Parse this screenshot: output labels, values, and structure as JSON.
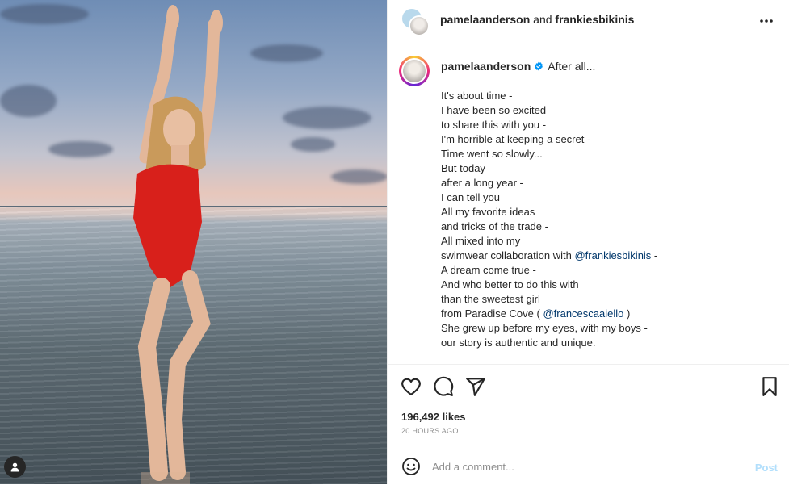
{
  "post": {
    "authors": "pamelaanderson",
    "authors_joiner": "and",
    "collaborator": "frankiesbikinis",
    "colors": {
      "accent": "#0095f6",
      "post_disabled": "#b2dffc",
      "mention": "#00376b",
      "swimsuit": "#d8201b"
    }
  },
  "caption": {
    "username": "pamelaanderson",
    "verified_icon": "verified-badge-icon",
    "title": "After all...",
    "lines": [
      "It's about time -",
      "I have been so excited",
      "to share this with you -",
      "I'm horrible at keeping a secret -",
      "Time went so slowly...",
      "But today",
      "after a long year -",
      "I can tell you",
      "All my favorite ideas",
      "and tricks of the trade -",
      "All mixed into my"
    ],
    "line12_pre": "swimwear collaboration with",
    "line12_mention": "@frankiesbikinis",
    "line12_post": " -",
    "line13": "A dream come true -",
    "line14": "And who better to do this with",
    "line15": "than the sweetest girl",
    "line16_pre": "from Paradise Cove (",
    "line16_mention": "@francescaaiello",
    "line16_post": " )",
    "line17": "She grew up before my eyes, with my boys -",
    "line18": "our story is authentic and unique."
  },
  "stats": {
    "likes": "196,492 likes",
    "time": "20 HOURS AGO"
  },
  "comment": {
    "placeholder": "Add a comment...",
    "post_label": "Post"
  },
  "icons": [
    "more-options-icon",
    "like-heart-icon",
    "comment-bubble-icon",
    "share-send-icon",
    "save-bookmark-icon",
    "emoji-icon",
    "tagged-user-icon"
  ]
}
